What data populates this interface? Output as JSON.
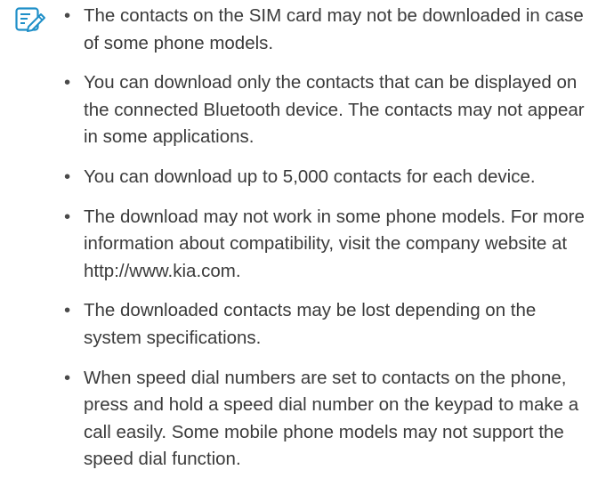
{
  "note": {
    "icon": "note-pencil-icon",
    "items": [
      "The contacts on the SIM card may not be downloaded in case of some phone models.",
      "You can download only the contacts that can be displayed on the connected Bluetooth device. The contacts may not appear in some applications.",
      "You can download up to 5,000 contacts for each device.",
      "The download may not work in some phone models. For more information about compatibility, visit the company website at http://www.kia.com.",
      "The downloaded contacts may be lost depending on the system specifications.",
      "When speed dial numbers are set to contacts on the phone, press and hold a speed dial number on the keypad to make a call easily. Some mobile phone models may not support the speed dial function."
    ]
  },
  "colors": {
    "icon": "#1f8fc8",
    "text": "#3b3b3b"
  }
}
